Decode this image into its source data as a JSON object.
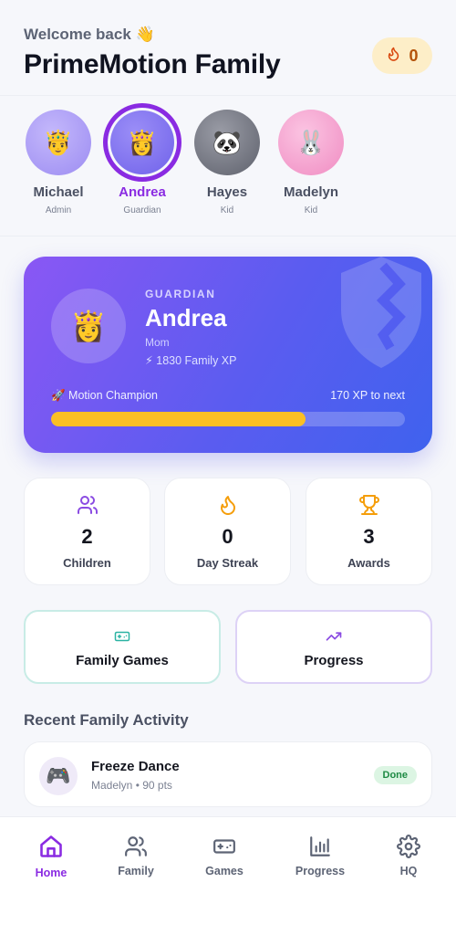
{
  "header": {
    "welcome": "Welcome back 👋",
    "family_name": "PrimeMotion Family",
    "streak_count": "0"
  },
  "members": [
    {
      "name": "Michael",
      "role": "Admin",
      "avatar": "🤴",
      "color": "#a89af5"
    },
    {
      "name": "Andrea",
      "role": "Guardian",
      "avatar": "👸",
      "color": "#7b6df0"
    },
    {
      "name": "Hayes",
      "role": "Kid",
      "avatar": "🐼",
      "color": "#6e717c"
    },
    {
      "name": "Madelyn",
      "role": "Kid",
      "avatar": "🐰",
      "color": "#f3a3cf"
    }
  ],
  "selected_member": "Andrea",
  "hero": {
    "role": "GUARDIAN",
    "name": "Andrea",
    "relation": "Mom",
    "xp": "⚡ 1830 Family XP",
    "level_title": "🚀 Motion Champion",
    "to_next": "170 XP to next",
    "progress_fraction": 0.72
  },
  "stats": [
    {
      "value": "2",
      "label": "Children",
      "icon": "users-icon",
      "color": "#8a4be2"
    },
    {
      "value": "0",
      "label": "Day Streak",
      "icon": "flame-icon",
      "color": "#f59e0b"
    },
    {
      "value": "3",
      "label": "Awards",
      "icon": "trophy-icon",
      "color": "#f59e0b"
    }
  ],
  "actions": {
    "games_label": "Family Games",
    "progress_label": "Progress"
  },
  "recent": {
    "title": "Recent Family Activity",
    "items": [
      {
        "title": "Freeze Dance",
        "sub": "Madelyn • 90 pts",
        "status": "Done",
        "avatar": "🎮"
      }
    ]
  },
  "nav": [
    {
      "label": "Home",
      "icon": "home-icon"
    },
    {
      "label": "Family",
      "icon": "users-icon"
    },
    {
      "label": "Games",
      "icon": "gamepad-icon"
    },
    {
      "label": "Progress",
      "icon": "bar-chart-icon"
    },
    {
      "label": "HQ",
      "icon": "gear-icon"
    }
  ],
  "active_nav": "Home"
}
